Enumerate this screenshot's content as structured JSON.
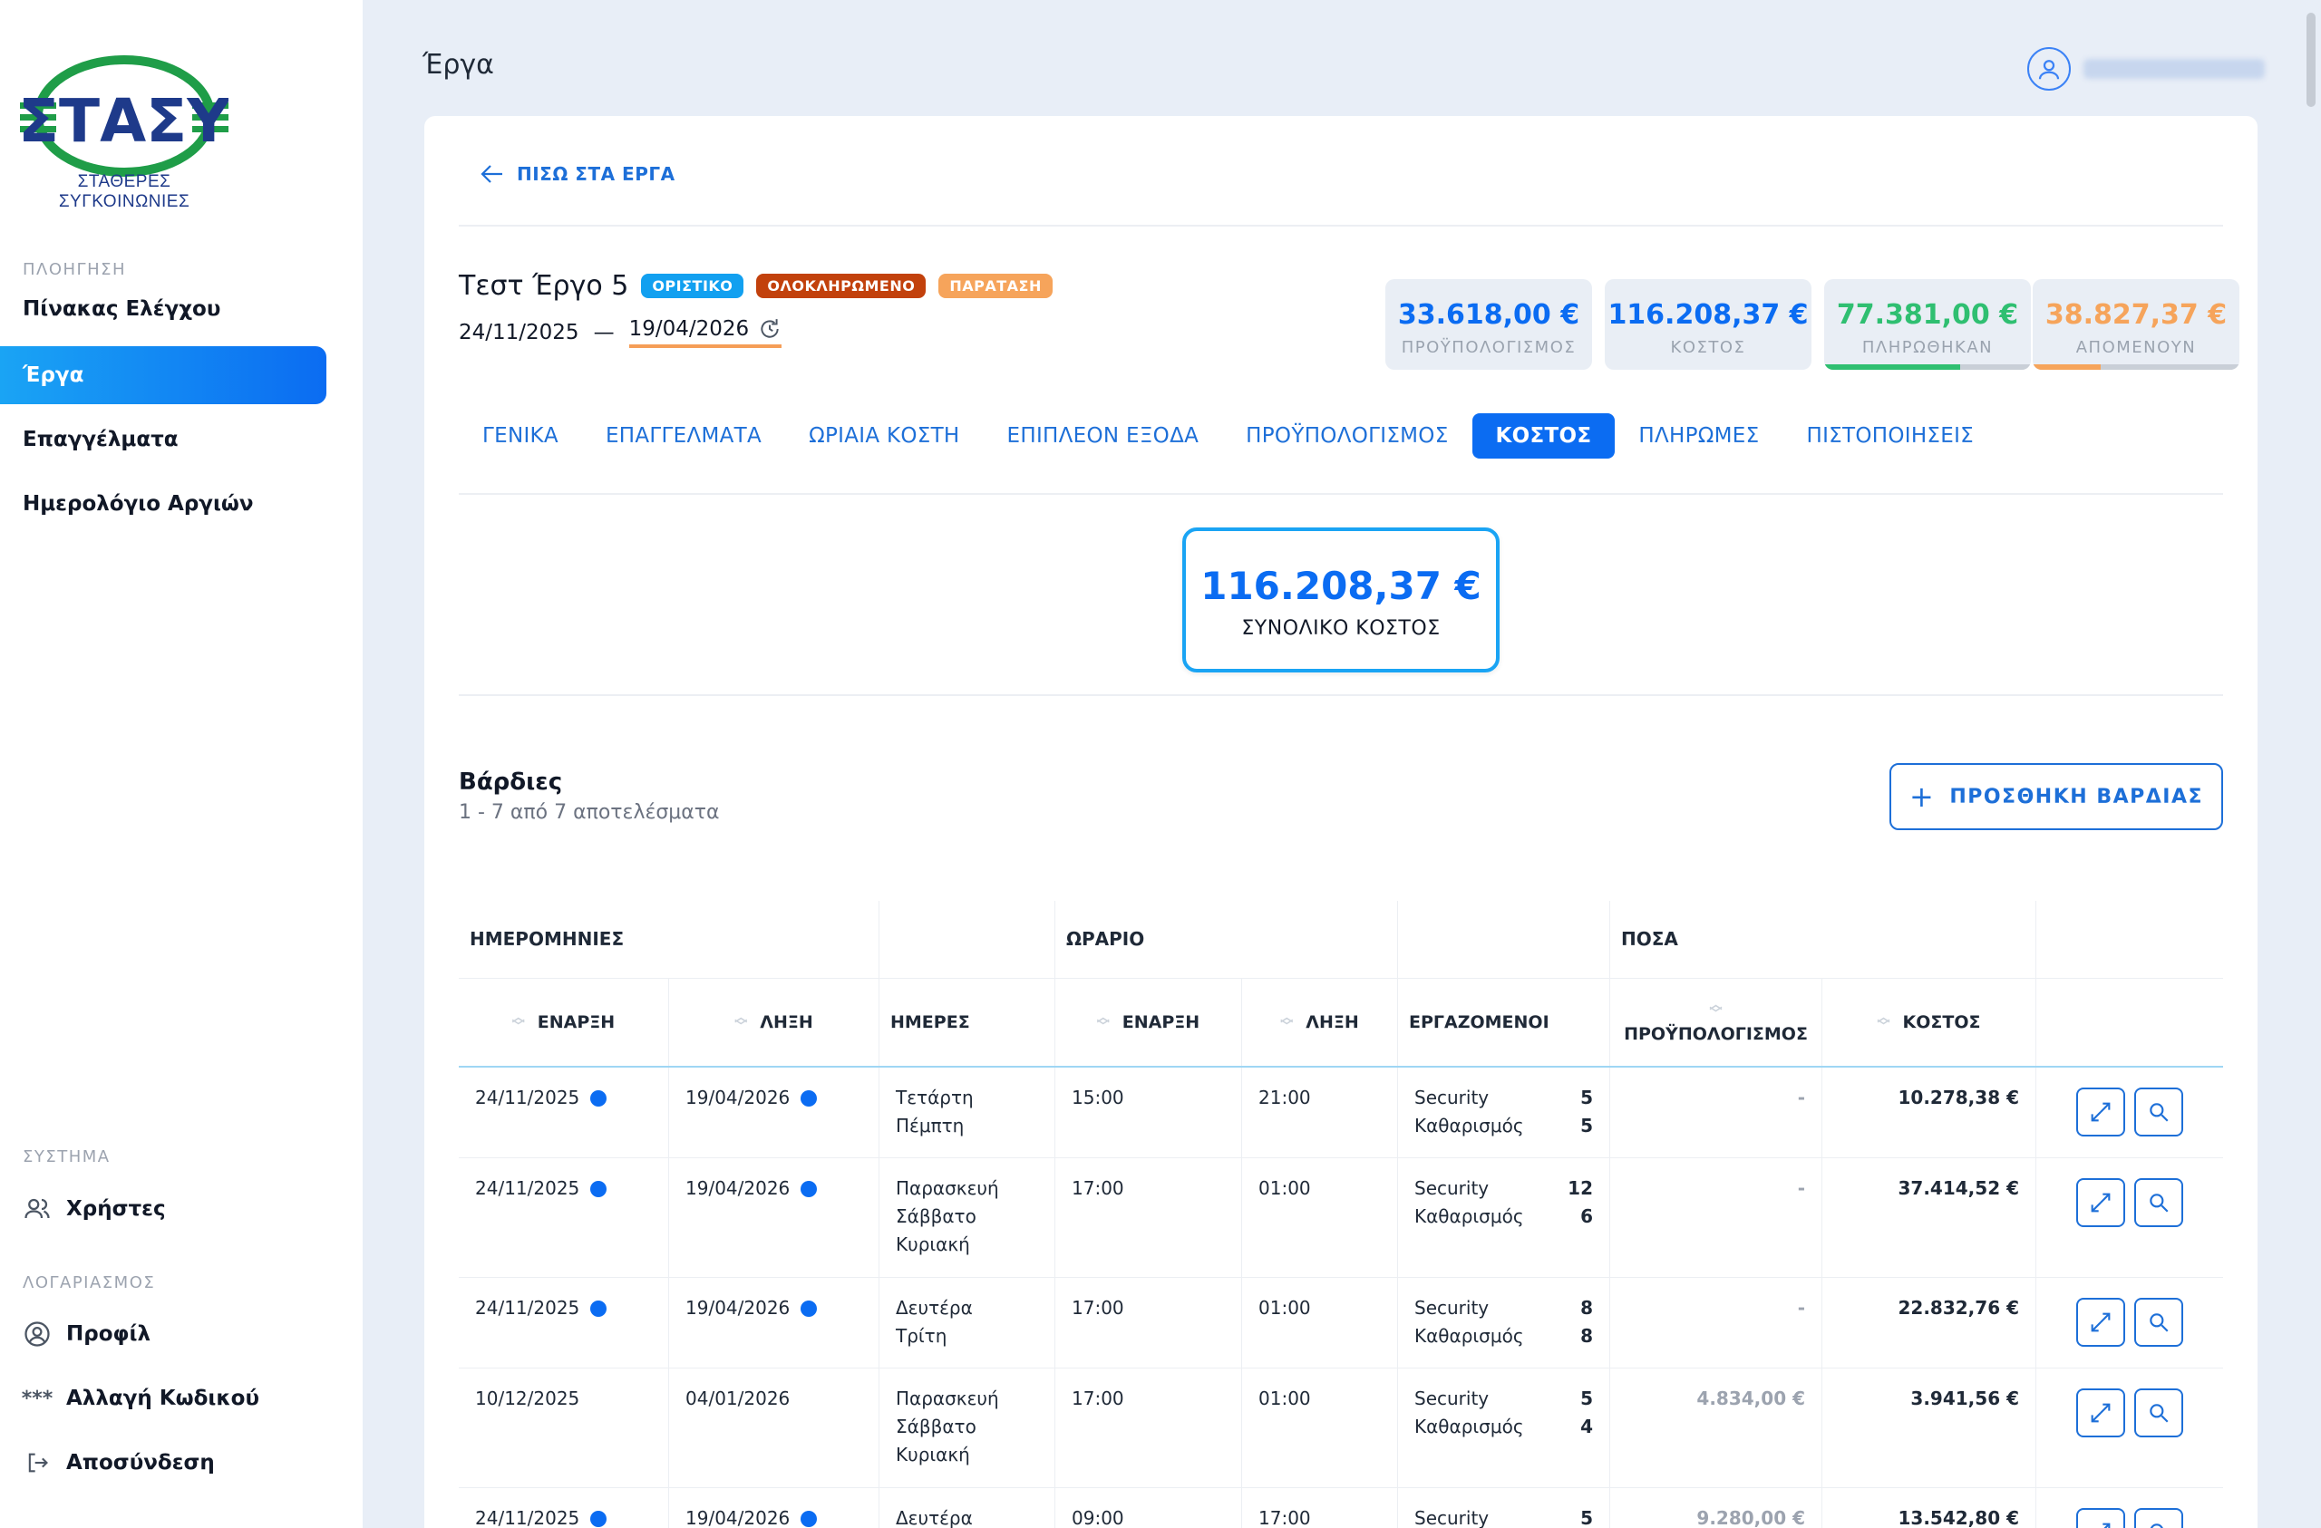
{
  "sidebar": {
    "logo_text": "ΣΤΑΣΥ",
    "logo_caption": "ΣΤΑΘΕΡΕΣ ΣΥΓΚΟΙΝΩΝΙΕΣ",
    "nav_section": "ΠΛΟΗΓΗΣΗ",
    "nav": [
      {
        "label": "Πίνακας Ελέγχου"
      },
      {
        "label": "Έργα"
      },
      {
        "label": "Επαγγέλματα"
      },
      {
        "label": "Ημερολόγιο Αργιών"
      }
    ],
    "system_section": "ΣΥΣΤΗΜΑ",
    "system_items": [
      {
        "label": "Χρήστες"
      }
    ],
    "account_section": "ΛΟΓΑΡΙΑΣΜΟΣ",
    "account_items": [
      {
        "label": "Προφίλ"
      },
      {
        "label": "Αλλαγή Κωδικού"
      },
      {
        "label": "Αποσύνδεση"
      }
    ]
  },
  "header": {
    "title": "Έργα"
  },
  "project": {
    "back_label": "ΠΙΣΩ ΣΤΑ ΕΡΓΑ",
    "title": "Τεστ Έργο 5",
    "badges": [
      {
        "label": "ΟΡΙΣΤΙΚΟ",
        "color": "#12a0f0"
      },
      {
        "label": "ΟΛΟΚΛΗΡΩΜΕΝΟ",
        "color": "#c2410c"
      },
      {
        "label": "ΠΑΡΑΤΑΣΗ",
        "color": "#f6a45b"
      }
    ],
    "start_date": "24/11/2025",
    "date_separator": "—",
    "end_date": "19/04/2026"
  },
  "stats": [
    {
      "value": "33.618,00 €",
      "label": "ΠΡΟΫΠΟΛΟΓΙΣΜΟΣ",
      "color": "#0b6cf2"
    },
    {
      "value": "116.208,37 €",
      "label": "ΚΟΣΤΟΣ",
      "color": "#0b6cf2"
    },
    {
      "value": "77.381,00 €",
      "label": "ΠΛΗΡΩΘΗΚΑΝ",
      "color": "#2fbf71",
      "progress": 0.66
    },
    {
      "value": "38.827,37 €",
      "label": "ΑΠΟΜΕΝΟΥΝ",
      "color": "#f6a45b",
      "progress": 0.33
    }
  ],
  "tabs": [
    {
      "label": "ΓΕΝΙΚΑ"
    },
    {
      "label": "ΕΠΑΓΓΕΛΜΑΤΑ"
    },
    {
      "label": "ΩΡΙΑΙΑ ΚΟΣΤΗ"
    },
    {
      "label": "ΕΠΙΠΛΕΟΝ ΕΞΟΔΑ"
    },
    {
      "label": "ΠΡΟΫΠΟΛΟΓΙΣΜΟΣ"
    },
    {
      "label": "ΚΟΣΤΟΣ"
    },
    {
      "label": "ΠΛΗΡΩΜΕΣ"
    },
    {
      "label": "ΠΙΣΤΟΠΟΙΗΣΕΙΣ"
    }
  ],
  "total": {
    "value": "116.208,37 €",
    "label": "ΣΥΝΟΛΙΚΟ ΚΟΣΤΟΣ"
  },
  "shifts": {
    "title": "Βάρδιες",
    "count": "1 - 7 από 7 αποτελέσματα",
    "add_label": "ΠΡΟΣΘΗΚΗ ΒΑΡΔΙΑΣ",
    "groups": {
      "dates": "ΗΜΕΡΟΜΗΝΙΕΣ",
      "hours": "ΩΡΑΡΙΟ",
      "amounts": "ΠΟΣΑ"
    },
    "columns": {
      "start": "ΕΝΑΡΞΗ",
      "end": "ΛΗΞΗ",
      "days": "ΗΜΕΡΕΣ",
      "time_start": "ΕΝΑΡΞΗ",
      "time_end": "ΛΗΞΗ",
      "employees": "ΕΡΓΑΖΟΜΕΝΟΙ",
      "budget": "ΠΡΟΫΠΟΛΟΓΙΣΜΟΣ",
      "cost": "ΚΟΣΤΟΣ"
    },
    "rows": [
      {
        "start": "24/11/2025",
        "end": "19/04/2026",
        "days": "Τετάρτη\nΠέμπτη",
        "time_start": "15:00",
        "time_end": "21:00",
        "employees": [
          {
            "role": "Security",
            "count": "5"
          },
          {
            "role": "Καθαρισμός",
            "count": "5"
          }
        ],
        "budget": "-",
        "cost": "10.278,38 €"
      },
      {
        "start": "24/11/2025",
        "end": "19/04/2026",
        "days": "Παρασκευή\nΣάββατο\nΚυριακή",
        "time_start": "17:00",
        "time_end": "01:00",
        "employees": [
          {
            "role": "Security",
            "count": "12"
          },
          {
            "role": "Καθαρισμός",
            "count": "6"
          }
        ],
        "budget": "-",
        "cost": "37.414,52 €"
      },
      {
        "start": "24/11/2025",
        "end": "19/04/2026",
        "days": "Δευτέρα\nΤρίτη",
        "time_start": "17:00",
        "time_end": "01:00",
        "employees": [
          {
            "role": "Security",
            "count": "8"
          },
          {
            "role": "Καθαρισμός",
            "count": "8"
          }
        ],
        "budget": "-",
        "cost": "22.832,76 €"
      },
      {
        "start": "10/12/2025",
        "end": "04/01/2026",
        "days": "Παρασκευή\nΣάββατο\nΚυριακή",
        "time_start": "17:00",
        "time_end": "01:00",
        "employees": [
          {
            "role": "Security",
            "count": "5"
          },
          {
            "role": "Καθαρισμός",
            "count": "4"
          }
        ],
        "budget": "4.834,00 €",
        "cost": "3.941,56 €"
      },
      {
        "start": "24/11/2025",
        "end": "19/04/2026",
        "days": "Δευτέρα",
        "time_start": "09:00",
        "time_end": "17:00",
        "employees": [
          {
            "role": "Security",
            "count": "5"
          }
        ],
        "budget": "9.280,00 €",
        "cost": "13.542,80 €"
      }
    ]
  }
}
